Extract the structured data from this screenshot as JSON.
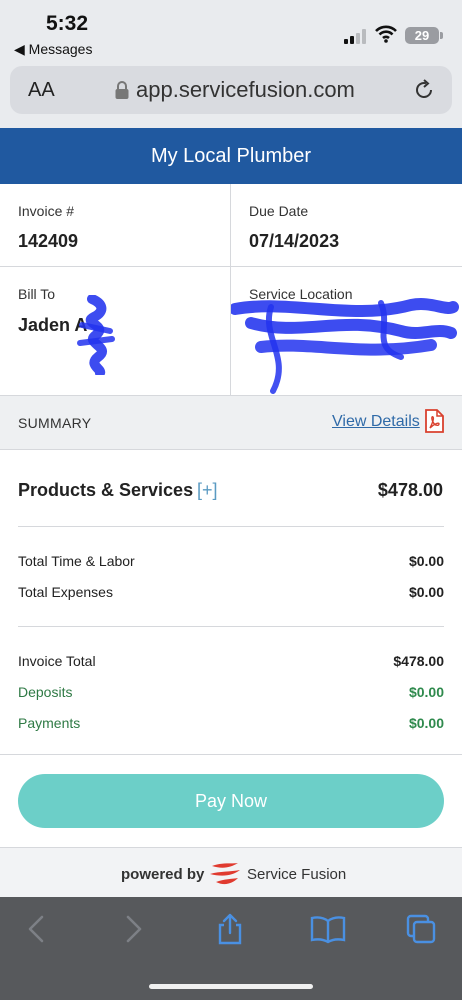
{
  "status_bar": {
    "time": "5:32",
    "back_app": "◀ Messages",
    "battery": "29"
  },
  "browser": {
    "text_size_label": "AA",
    "url": "app.servicefusion.com"
  },
  "header": {
    "title": "My Local Plumber"
  },
  "invoice": {
    "invoice_label": "Invoice #",
    "invoice_number": "142409",
    "due_label": "Due Date",
    "due_date": "07/14/2023",
    "bill_to_label": "Bill To",
    "bill_to_name": "Jaden A",
    "service_location_label": "Service Location"
  },
  "summary": {
    "label": "SUMMARY",
    "view_details": "View Details"
  },
  "products": {
    "label": "Products & Services",
    "expand": "[+]",
    "amount": "$478.00"
  },
  "costs": [
    {
      "label": "Total Time & Labor",
      "amount": "$0.00"
    },
    {
      "label": "Total Expenses",
      "amount": "$0.00"
    }
  ],
  "totals": [
    {
      "label": "Invoice Total",
      "amount": "$478.00"
    },
    {
      "label": "Deposits",
      "amount": "$0.00"
    },
    {
      "label": "Payments",
      "amount": "$0.00"
    }
  ],
  "pay_button": "Pay Now",
  "footer": {
    "powered_by": "powered by",
    "brand": "Service Fusion"
  },
  "colors": {
    "header": "#2059a0",
    "pay_button": "#6ccfc8",
    "positive": "#2f8a4d",
    "link": "#2f6aa8",
    "redaction": "#2233ee"
  },
  "icons": [
    "lock-icon",
    "reload-icon",
    "pdf-icon",
    "service-fusion-logo",
    "back-icon",
    "forward-icon",
    "share-icon",
    "bookmarks-icon",
    "tabs-icon"
  ]
}
